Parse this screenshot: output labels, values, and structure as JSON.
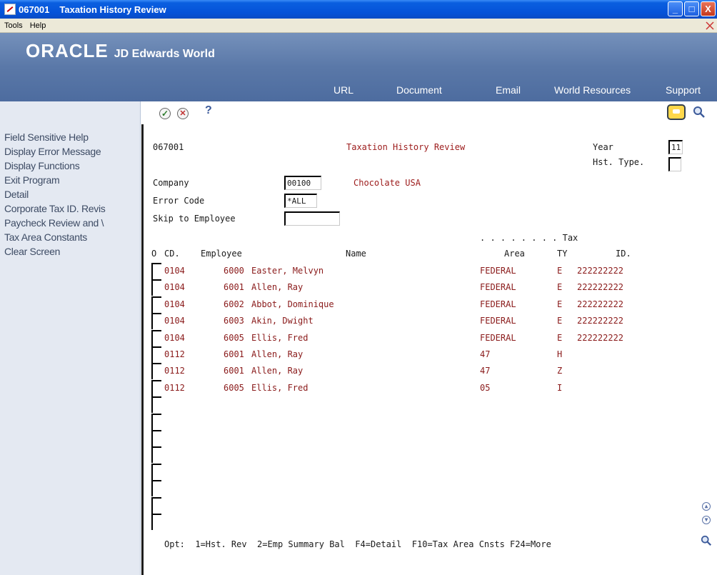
{
  "window": {
    "code": "067001",
    "title": "Taxation History Review",
    "buttons": {
      "minimize": "_",
      "maximize": "□",
      "close": "X"
    }
  },
  "menu": {
    "tools": "Tools",
    "help": "Help"
  },
  "banner": {
    "brand": "ORACLE",
    "product": "JD Edwards World",
    "links": [
      "URL",
      "Document",
      "Email",
      "World Resources",
      "Support"
    ]
  },
  "sidebar": {
    "items": [
      "Field Sensitive Help",
      "Display Error Message",
      "Display Functions",
      "Exit Program",
      "Detail",
      "Corporate Tax ID. Revis",
      "Paycheck Review and \\",
      "Tax Area Constants",
      "Clear Screen"
    ]
  },
  "toolbar": {
    "ok": "✓",
    "cancel": "✕",
    "help": "?"
  },
  "form": {
    "program_id": "067001",
    "screen_title": "Taxation History Review",
    "year_label": "Year",
    "year_value": "11",
    "hst_type_label": "Hst. Type.",
    "hst_type_value": "",
    "company_label": "Company",
    "company_value": "00100",
    "company_name": "Chocolate USA",
    "error_code_label": "Error Code",
    "error_code_value": "*ALL",
    "skip_label": "Skip to Employee",
    "skip_value": "",
    "tax_group_label": ". . . . . . . . Tax",
    "columns": {
      "o": "O",
      "cd": "CD.",
      "employee": "Employee",
      "name": "Name",
      "area": "Area",
      "ty": "TY",
      "id": "ID."
    },
    "rows": [
      {
        "cd": "0104",
        "employee": "6000",
        "name": "Easter, Melvyn",
        "area": "FEDERAL",
        "ty": "E",
        "id": "222222222"
      },
      {
        "cd": "0104",
        "employee": "6001",
        "name": "Allen, Ray",
        "area": "FEDERAL",
        "ty": "E",
        "id": "222222222"
      },
      {
        "cd": "0104",
        "employee": "6002",
        "name": "Abbot, Dominique",
        "area": "FEDERAL",
        "ty": "E",
        "id": "222222222"
      },
      {
        "cd": "0104",
        "employee": "6003",
        "name": "Akin, Dwight",
        "area": "FEDERAL",
        "ty": "E",
        "id": "222222222"
      },
      {
        "cd": "0104",
        "employee": "6005",
        "name": "Ellis, Fred",
        "area": "FEDERAL",
        "ty": "E",
        "id": "222222222"
      },
      {
        "cd": "0112",
        "employee": "6001",
        "name": "Allen, Ray",
        "area": "47",
        "ty": "H",
        "id": ""
      },
      {
        "cd": "0112",
        "employee": "6001",
        "name": "Allen, Ray",
        "area": "47",
        "ty": "Z",
        "id": ""
      },
      {
        "cd": "0112",
        "employee": "6005",
        "name": "Ellis, Fred",
        "area": "05",
        "ty": "I",
        "id": ""
      }
    ],
    "empty_rows": 8,
    "footer": "Opt:  1=Hst. Rev  2=Emp Summary Bal  F4=Detail  F10=Tax Area Cnsts F24=More"
  },
  "colors": {
    "title_bar": "#0552d8",
    "banner": "#5a78a8",
    "data_text": "#8a1a1a",
    "screen_title": "#9c1b1b",
    "sidebar_bg": "#e4e9f2"
  },
  "icons": {
    "app": "jde-app-icon",
    "ok": "check-circle-icon",
    "cancel": "x-circle-icon",
    "help": "question-icon",
    "chat": "chat-bubble-icon",
    "search": "magnifier-icon",
    "page_up": "chevron-up-circle-icon",
    "page_down": "chevron-down-circle-icon"
  }
}
